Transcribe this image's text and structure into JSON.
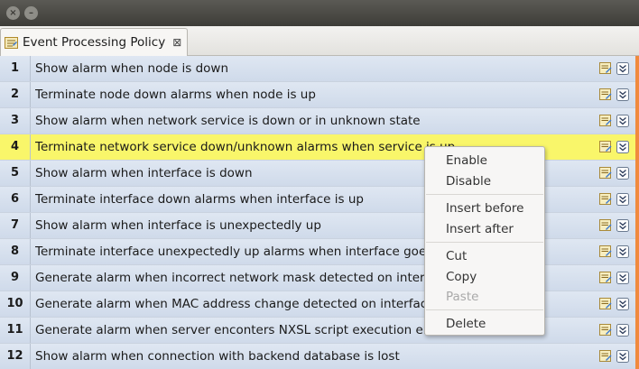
{
  "window": {
    "close_glyph": "×",
    "minimize_glyph": "–"
  },
  "tab": {
    "label": "Event Processing Policy",
    "close_glyph": "⊠"
  },
  "toolbar": {
    "icons": [
      "save-icon",
      "expand-all-icon",
      "collapse-all-icon",
      "view-mode-icon",
      "list-view-icon",
      "cut-icon",
      "copy-icon",
      "paste-icon",
      "delete-icon",
      "view-menu-icon"
    ]
  },
  "rules": [
    {
      "num": "1",
      "text": "Show alarm when node is down"
    },
    {
      "num": "2",
      "text": "Terminate node down alarms when node is up"
    },
    {
      "num": "3",
      "text": "Show alarm when network service is down or in unknown state"
    },
    {
      "num": "4",
      "text": "Terminate network service down/unknown alarms when service is up"
    },
    {
      "num": "5",
      "text": "Show alarm when interface is down"
    },
    {
      "num": "6",
      "text": "Terminate interface down alarms when interface is up"
    },
    {
      "num": "7",
      "text": "Show alarm when interface is unexpectedly up"
    },
    {
      "num": "8",
      "text": "Terminate interface unexpectedly up alarms when interface goes"
    },
    {
      "num": "9",
      "text": "Generate alarm when incorrect network mask detected on interfa"
    },
    {
      "num": "10",
      "text": "Generate alarm when MAC address change detected on interface"
    },
    {
      "num": "11",
      "text": "Generate alarm when server enconters NXSL script execution erro"
    },
    {
      "num": "12",
      "text": "Show alarm when connection with backend database is lost"
    }
  ],
  "selected_row": "4",
  "context_menu": {
    "enable": "Enable",
    "disable": "Disable",
    "insert_before": "Insert before",
    "insert_after": "Insert after",
    "cut": "Cut",
    "copy": "Copy",
    "paste": "Paste",
    "delete": "Delete"
  },
  "colors": {
    "selected_row": "#f9f66a",
    "row_bg": "#d8e2ef",
    "accent_bar": "#f08a3e",
    "delete_red": "#e02020"
  }
}
